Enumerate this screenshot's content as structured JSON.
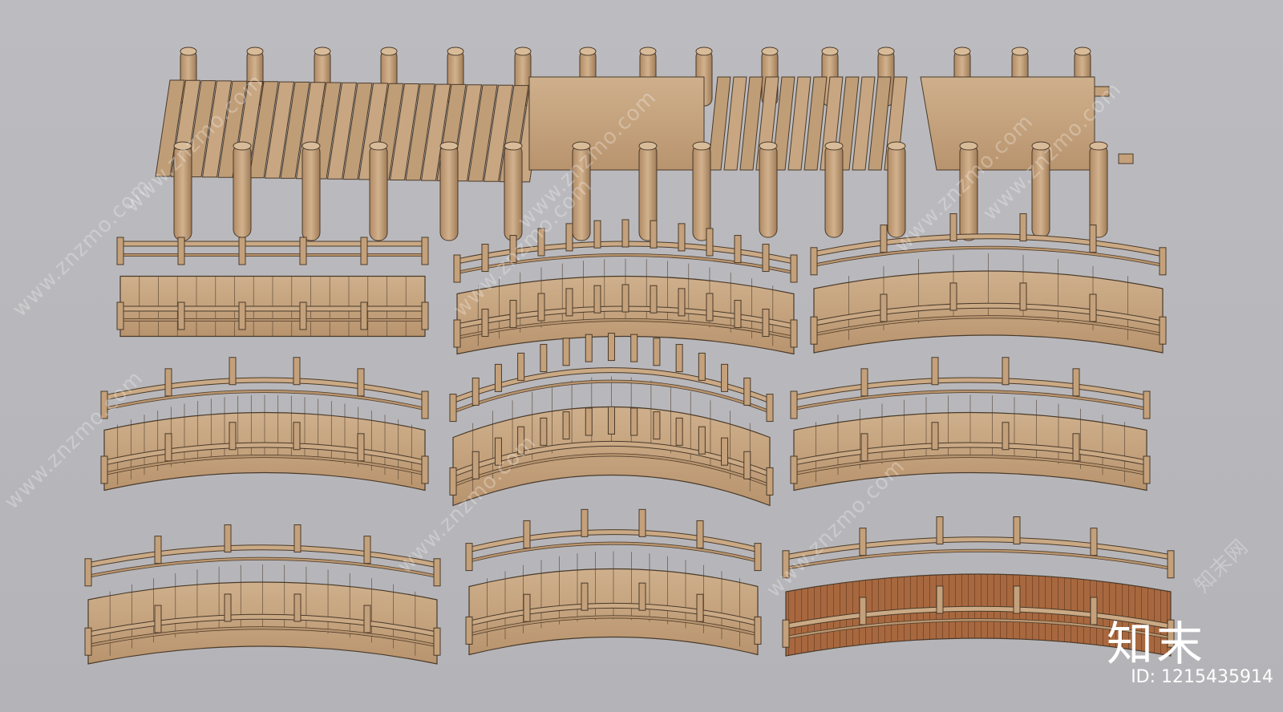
{
  "watermark": {
    "site_text": "www.znzmo.com",
    "brand_cn": "知末网",
    "logo_text": "知末",
    "id_text": "ID: 1215435914"
  },
  "colors": {
    "background": "#b9b9bd",
    "wood_light": "#c9a985",
    "wood_mid": "#b8946e",
    "wood_dark": "#a07c58",
    "plank_red": "#a8683f",
    "outline": "#4a3a2a"
  },
  "scene": {
    "description_free": true,
    "bridges": [
      {
        "name": "bridge-flat-rails",
        "style": "flat"
      },
      {
        "name": "bridge-arched-posts",
        "style": "arched-posts"
      },
      {
        "name": "bridge-curved-planks",
        "style": "curved"
      },
      {
        "name": "bridge-slatted-rails",
        "style": "slatted"
      },
      {
        "name": "bridge-moon-arch",
        "style": "moon"
      },
      {
        "name": "bridge-round-rail",
        "style": "round-rail"
      },
      {
        "name": "bridge-low-arch",
        "style": "low-arch"
      },
      {
        "name": "bridge-post-caps",
        "style": "post-caps"
      },
      {
        "name": "bridge-red-deck",
        "style": "red-deck"
      }
    ]
  }
}
